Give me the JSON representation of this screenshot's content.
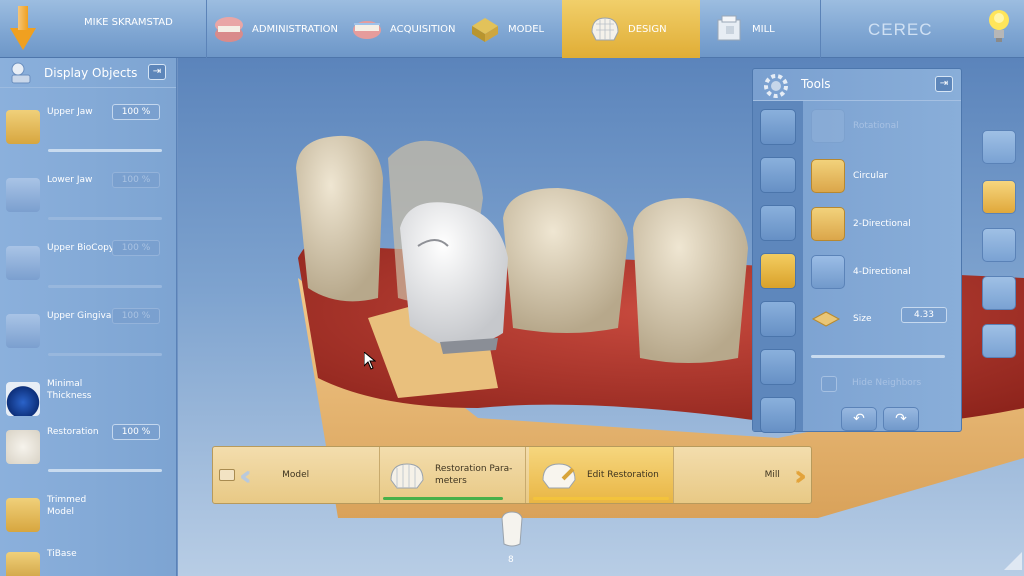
{
  "header": {
    "user_name": "MIKE SKRAMSTAD",
    "steps": [
      {
        "label": "ADMINISTRATION",
        "icon": "jaw-icon"
      },
      {
        "label": "ACQUISITION",
        "icon": "jaw-scan-icon"
      },
      {
        "label": "MODEL",
        "icon": "model-icon"
      },
      {
        "label": "DESIGN",
        "icon": "crown-icon",
        "active": true
      },
      {
        "label": "MILL",
        "icon": "mill-icon"
      }
    ],
    "logo": "CEREC"
  },
  "display_objects": {
    "title": "Display Objects",
    "items": [
      {
        "name": "Upper Jaw",
        "value": "100 %",
        "enabled": true
      },
      {
        "name": "Lower Jaw",
        "value": "100 %",
        "enabled": false
      },
      {
        "name": "Upper BioCopy",
        "value": "100 %",
        "enabled": false
      },
      {
        "name": "Upper Gingiva",
        "value": "100 %",
        "enabled": false
      },
      {
        "name": "Minimal\nThickness",
        "value": "",
        "enabled": true
      },
      {
        "name": "Restoration",
        "value": "100 %",
        "enabled": true
      },
      {
        "name": "Trimmed\nModel",
        "value": "",
        "enabled": true
      },
      {
        "name": "TiBase",
        "value": "",
        "enabled": true
      }
    ]
  },
  "tools": {
    "title": "Tools",
    "options": [
      {
        "label": "Rotational",
        "enabled": false
      },
      {
        "label": "Circular",
        "enabled": true
      },
      {
        "label": "2-Directional",
        "enabled": true
      },
      {
        "label": "4-Directional",
        "enabled": true
      }
    ],
    "size_label": "Size",
    "size_value": "4.33",
    "hide_neighbors_label": "Hide Neighbors"
  },
  "phases": {
    "items": [
      {
        "label": "Model"
      },
      {
        "label": "Restoration Para-\nmeters"
      },
      {
        "label": "Edit Restoration"
      },
      {
        "label": "Mill"
      }
    ]
  },
  "tooth_selector": {
    "number": "8"
  },
  "colors": {
    "accent": "#e8b443",
    "panel": "#7da4d2",
    "progress_done": "#48b04a",
    "progress_active": "#f3c33c"
  }
}
